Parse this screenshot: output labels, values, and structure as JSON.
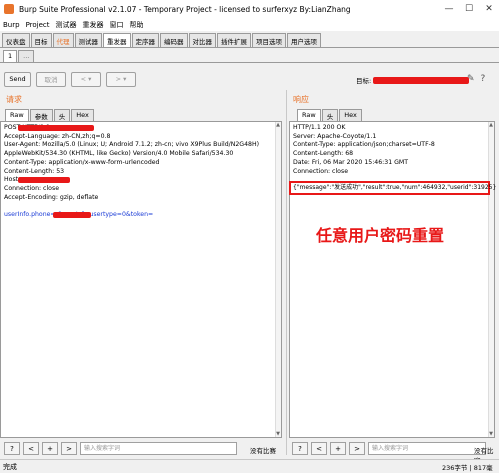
{
  "window": {
    "title": "Burp Suite Professional v2.1.07 - Temporary Project - licensed to surferxyz By:LianZhang",
    "controls": [
      "—",
      "☐",
      "✕"
    ]
  },
  "menu": [
    "Burp",
    "Project",
    "测试器",
    "重发器",
    "窗口",
    "帮助"
  ],
  "tool_tabs": [
    "仪表盘",
    "目标",
    "代理",
    "测试器",
    "重发器",
    "定序器",
    "编码器",
    "对比器",
    "插件扩展",
    "项目选项",
    "用户选项"
  ],
  "sub_tabs": [
    "1",
    "..."
  ],
  "actions": {
    "send": "Send",
    "cancel": "取消",
    "back": "< ▾",
    "forward": "> ▾",
    "target_label": "目标: ",
    "edit_icon": "pencil-icon",
    "help_icon": "help-icon"
  },
  "request": {
    "title": "请求",
    "tabs": [
      "Raw",
      "参数",
      "头",
      "Hex"
    ],
    "lines": [
      "POST                                 HTTP/1.1",
      "Accept-Language: zh-CN,zh;q=0.8",
      "User-Agent: Mozilla/5.0 (Linux; U; Android 7.1.2; zh-cn; vivo X9Plus Build/N2G48H)",
      "AppleWebKit/534.30 (KHTML, like Gecko) Version/4.0 Mobile Safari/534.30",
      "Content-Type: application/x-www-form-urlencoded",
      "Content-Length: 53",
      "Host:",
      "Connection: close",
      "Accept-Encoding: gzip, deflate",
      "",
      "userInfo.phone=              &userInfo.usertype=0&token="
    ]
  },
  "response": {
    "title": "响应",
    "tabs": [
      "Raw",
      "头",
      "Hex"
    ],
    "lines": [
      "HTTP/1.1 200 OK",
      "Server: Apache-Coyote/1.1",
      "Content-Type: application/json;charset=UTF-8",
      "Content-Length: 68",
      "Date: Fri, 06 Mar 2020 15:46:31 GMT",
      "Connection: close",
      ""
    ],
    "json": "{\"message\":\"发送成功\",\"result\":true,\"num\":464932,\"userid\":31925}",
    "annotation": "任意用户密码重置"
  },
  "search": {
    "placeholder": "输入搜索字词",
    "buttons": [
      "?",
      "<",
      "+",
      ">"
    ],
    "no_match": "没有比赛"
  },
  "status": {
    "left": "完成",
    "right": "236字节 | 817毫秒"
  },
  "colors": {
    "accent": "#e8742c",
    "redact": "#e81818",
    "link_blue": "#1a3bd6"
  }
}
